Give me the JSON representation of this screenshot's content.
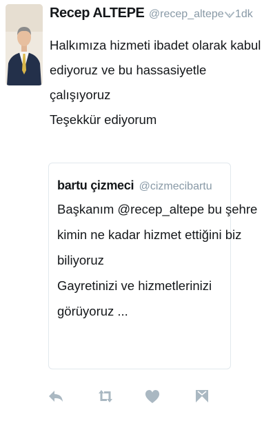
{
  "tweet": {
    "author_name": "Recep ALTEPE",
    "author_handle": "@recep_altepe",
    "separator": "·",
    "timestamp": "1dk",
    "text_lines": [
      "Halkımıza hizmeti ibadet olarak kabul",
      "ediyoruz ve bu hassasiyetle",
      "çalışıyoruz",
      "Teşekkür ediyorum"
    ]
  },
  "quoted_tweet": {
    "author_name": "bartu çizmeci",
    "author_handle": "@cizmecibartu",
    "text_lines": [
      "Başkanım @recep_altepe bu şehre",
      "kimin ne kadar hizmet ettiğini biz",
      "biliyoruz",
      "Gayretinizi ve hizmetlerinizi",
      "görüyoruz ..."
    ]
  },
  "actions": [
    {
      "name": "reply",
      "icon": "reply-icon"
    },
    {
      "name": "retweet",
      "icon": "retweet-icon"
    },
    {
      "name": "like",
      "icon": "heart-icon"
    },
    {
      "name": "direct-message",
      "icon": "dm-icon"
    }
  ],
  "colors": {
    "text": "#14171a",
    "secondary": "#8899a6",
    "icon": "#aab8c2",
    "border": "#e1e8ed"
  }
}
